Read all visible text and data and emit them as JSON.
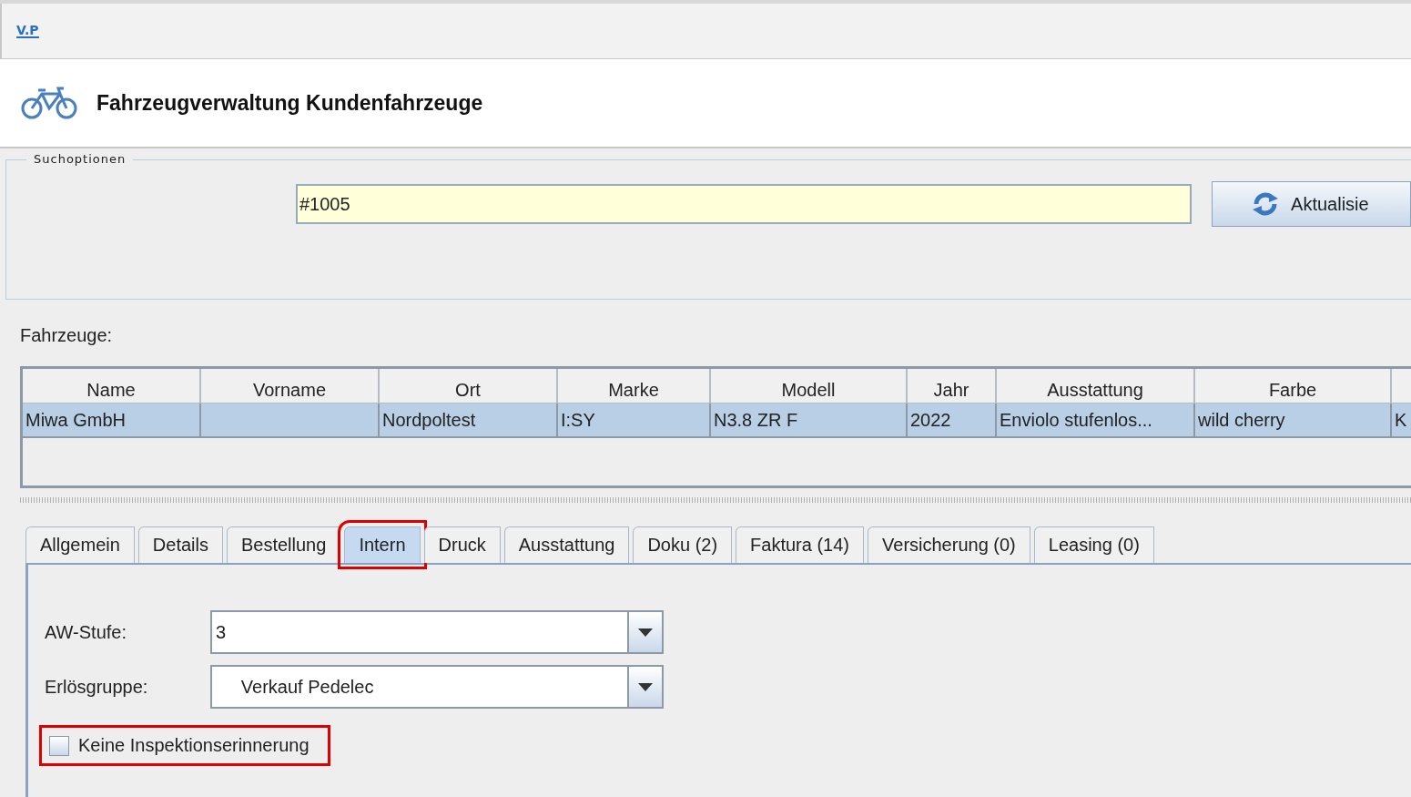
{
  "window": {
    "app_icon": "V.P",
    "title": "Fahrzeugverwaltung Kundenfahrzeuge"
  },
  "search_options": {
    "legend": "Suchoptionen",
    "value": "#1005",
    "button": "Aktualisie"
  },
  "vehicles": {
    "label": "Fahrzeuge:",
    "columns": [
      "Name",
      "Vorname",
      "Ort",
      "Marke",
      "Modell",
      "Jahr",
      "Ausstattung",
      "Farbe",
      ""
    ],
    "rows": [
      {
        "selected": true,
        "cells": [
          "Miwa GmbH",
          "",
          "Nordpoltest",
          "I:SY",
          "N3.8 ZR F",
          "2022",
          "Enviolo stufenlos...",
          "wild cherry",
          "K"
        ]
      }
    ]
  },
  "tabs": [
    {
      "label": "Allgemein",
      "selected": false,
      "highlighted": false
    },
    {
      "label": "Details",
      "selected": false,
      "highlighted": false
    },
    {
      "label": "Bestellung",
      "selected": false,
      "highlighted": false
    },
    {
      "label": "Intern",
      "selected": true,
      "highlighted": true
    },
    {
      "label": "Druck",
      "selected": false,
      "highlighted": false
    },
    {
      "label": "Ausstattung",
      "selected": false,
      "highlighted": false
    },
    {
      "label": "Doku (2)",
      "selected": false,
      "highlighted": false
    },
    {
      "label": "Faktura (14)",
      "selected": false,
      "highlighted": false
    },
    {
      "label": "Versicherung (0)",
      "selected": false,
      "highlighted": false
    },
    {
      "label": "Leasing (0)",
      "selected": false,
      "highlighted": false
    }
  ],
  "form": {
    "fields": [
      {
        "label": "AW-Stufe:",
        "value": "3"
      },
      {
        "label": "Erlösgruppe:",
        "value": "     Verkauf Pedelec"
      }
    ],
    "checkbox": {
      "label": "Keine Inspektionserinnerung",
      "checked": false,
      "highlighted": true
    }
  }
}
